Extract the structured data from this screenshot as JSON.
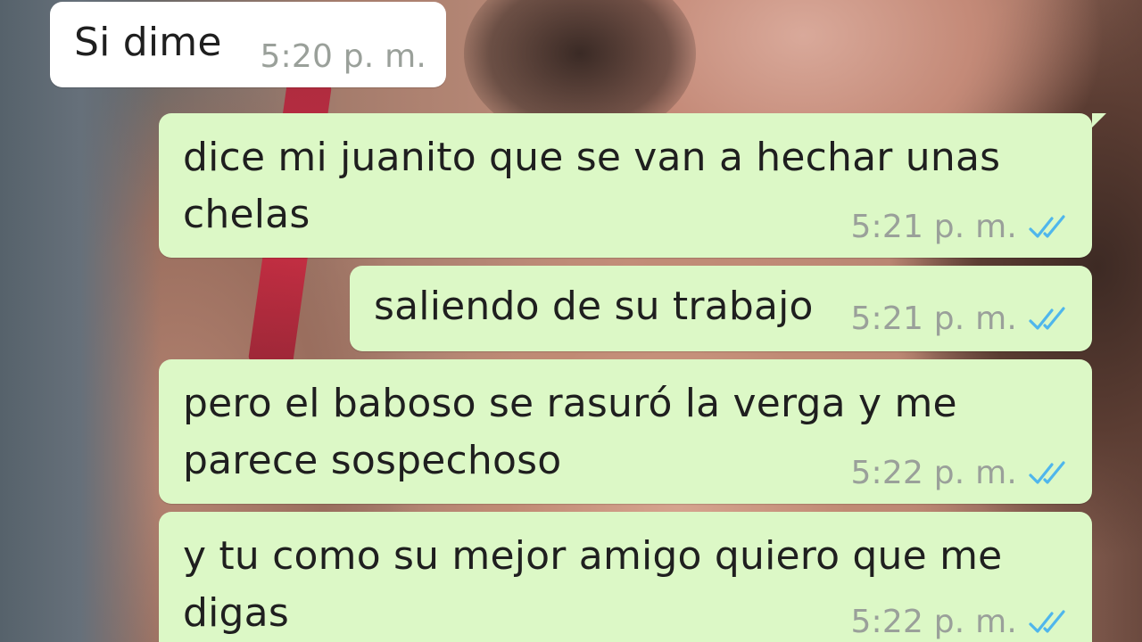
{
  "chat": {
    "messages": [
      {
        "direction": "incoming",
        "text": "Si dime",
        "time": "5:20 p. m."
      },
      {
        "direction": "outgoing",
        "text": "dice mi juanito que se van a hechar unas\nchelas",
        "time": "5:21 p. m.",
        "status": "read"
      },
      {
        "direction": "outgoing",
        "text": "saliendo de su trabajo",
        "time": "5:21 p. m.",
        "status": "read"
      },
      {
        "direction": "outgoing",
        "text": "pero el baboso se rasuró la verga y me\nparece sospechoso",
        "time": "5:22 p. m.",
        "status": "read"
      },
      {
        "direction": "outgoing",
        "text": "y tu como su mejor amigo quiero que me\ndigas",
        "time": "5:22 p. m.",
        "status": "read"
      }
    ]
  },
  "colors": {
    "incoming_bubble": "#ffffff",
    "outgoing_bubble": "#dcf8c6",
    "read_ticks": "#4fb6ec",
    "timestamp": "#9aa09a"
  },
  "icons": {
    "read_status": "double-check-icon"
  }
}
